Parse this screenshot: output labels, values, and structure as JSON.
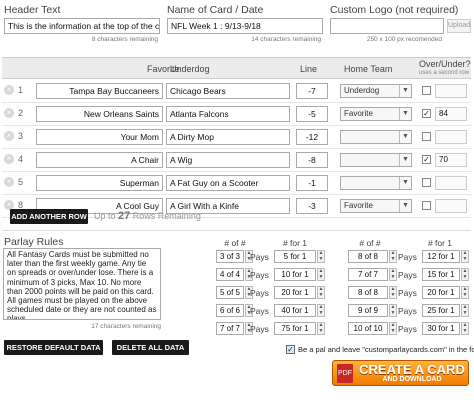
{
  "header": {
    "header_text_label": "Header Text",
    "header_text_value": "This is the information at the top of the card",
    "header_text_remaining": "8 characters remaining",
    "name_label": "Name of Card / Date",
    "name_value": "NFL Week 1 : 9/13-9/18",
    "name_remaining": "14 characters remaining",
    "logo_label": "Custom Logo (not required)",
    "logo_hint": "250 x 100 px recomended",
    "upload_label": "Upload"
  },
  "table": {
    "col_favorite": "Favorite",
    "col_underdog": "Underdog",
    "col_line": "Line",
    "col_home": "Home Team",
    "col_overunder": "Over/Under?",
    "col_overunder_sub": "uses a second row",
    "rows": [
      {
        "num": "1",
        "favorite": "Tampa Bay Buccaneers",
        "underdog": "Chicago Bears",
        "line": "-7",
        "home": "Underdog",
        "ou_checked": false,
        "ou_value": ""
      },
      {
        "num": "2",
        "favorite": "New Orleans Saints",
        "underdog": "Atlanta Falcons",
        "line": "-5",
        "home": "Favorite",
        "ou_checked": true,
        "ou_value": "84"
      },
      {
        "num": "3",
        "favorite": "Your Mom",
        "underdog": "A Dirty Mop",
        "line": "-12",
        "home": "",
        "ou_checked": false,
        "ou_value": ""
      },
      {
        "num": "4",
        "favorite": "A Chair",
        "underdog": "A Wig",
        "line": "-8",
        "home": "",
        "ou_checked": true,
        "ou_value": "70"
      },
      {
        "num": "5",
        "favorite": "Superman",
        "underdog": "A Fat Guy on a Scooter",
        "line": "-1",
        "home": "",
        "ou_checked": false,
        "ou_value": ""
      },
      {
        "num": "8",
        "favorite": "A Cool Guy",
        "underdog": "A Girl With a Kinfe",
        "line": "-3",
        "home": "Favorite",
        "ou_checked": false,
        "ou_value": ""
      }
    ],
    "add_row_label": "ADD ANOTHER ROW",
    "remaining_prefix": "Up to",
    "remaining_count": "27",
    "remaining_suffix": "Rows Remaining"
  },
  "parlay": {
    "title": "Parlay Rules",
    "rules_text": "All Fantasy Cards must be submitted no later than the first weekly game. Any tie on spreads or over/under lose. There is a minimum of 3 picks, Max 10. No more than 2000 points will be paid on this card. All games must be played on the above scheduled date or they are not counted as plays",
    "rules_remaining": "17 characters remaining",
    "col_num": "# of #",
    "col_for": "# for 1",
    "pays_label": "Pays",
    "left": [
      {
        "num": "3 of 3",
        "for": "5 for 1"
      },
      {
        "num": "4 of 4",
        "for": "10 for 1"
      },
      {
        "num": "5 of 5",
        "for": "20 for 1"
      },
      {
        "num": "6 of 6",
        "for": "40 for 1"
      },
      {
        "num": "7 of 7",
        "for": "75 for 1"
      }
    ],
    "right": [
      {
        "num": "8 of 8",
        "for": "12 for 1"
      },
      {
        "num": "7 of 7",
        "for": "15 for 1"
      },
      {
        "num": "8 of 8",
        "for": "20 for 1"
      },
      {
        "num": "9 of 9",
        "for": "25 for 1"
      },
      {
        "num": "10 of 10",
        "for": "30 for 1"
      }
    ]
  },
  "footer": {
    "restore_label": "RESTORE DEFAULT DATA",
    "delete_label": "DELETE ALL DATA",
    "pal_label": "Be a pal and leave \"customparlaycards.com\" in the footer.",
    "cta_big": "CREATE A CARD",
    "cta_small": "AND DOWNLOAD",
    "cta_icon": "PDF"
  },
  "icons": {
    "remove_row": "remove-row-icon",
    "dropdown": "chevron-down-icon",
    "pdf": "pdf-icon"
  },
  "colors": {
    "header_bg": "#ececec",
    "button_dark": "#1a1a1a",
    "cta_orange": "#f07c00"
  }
}
